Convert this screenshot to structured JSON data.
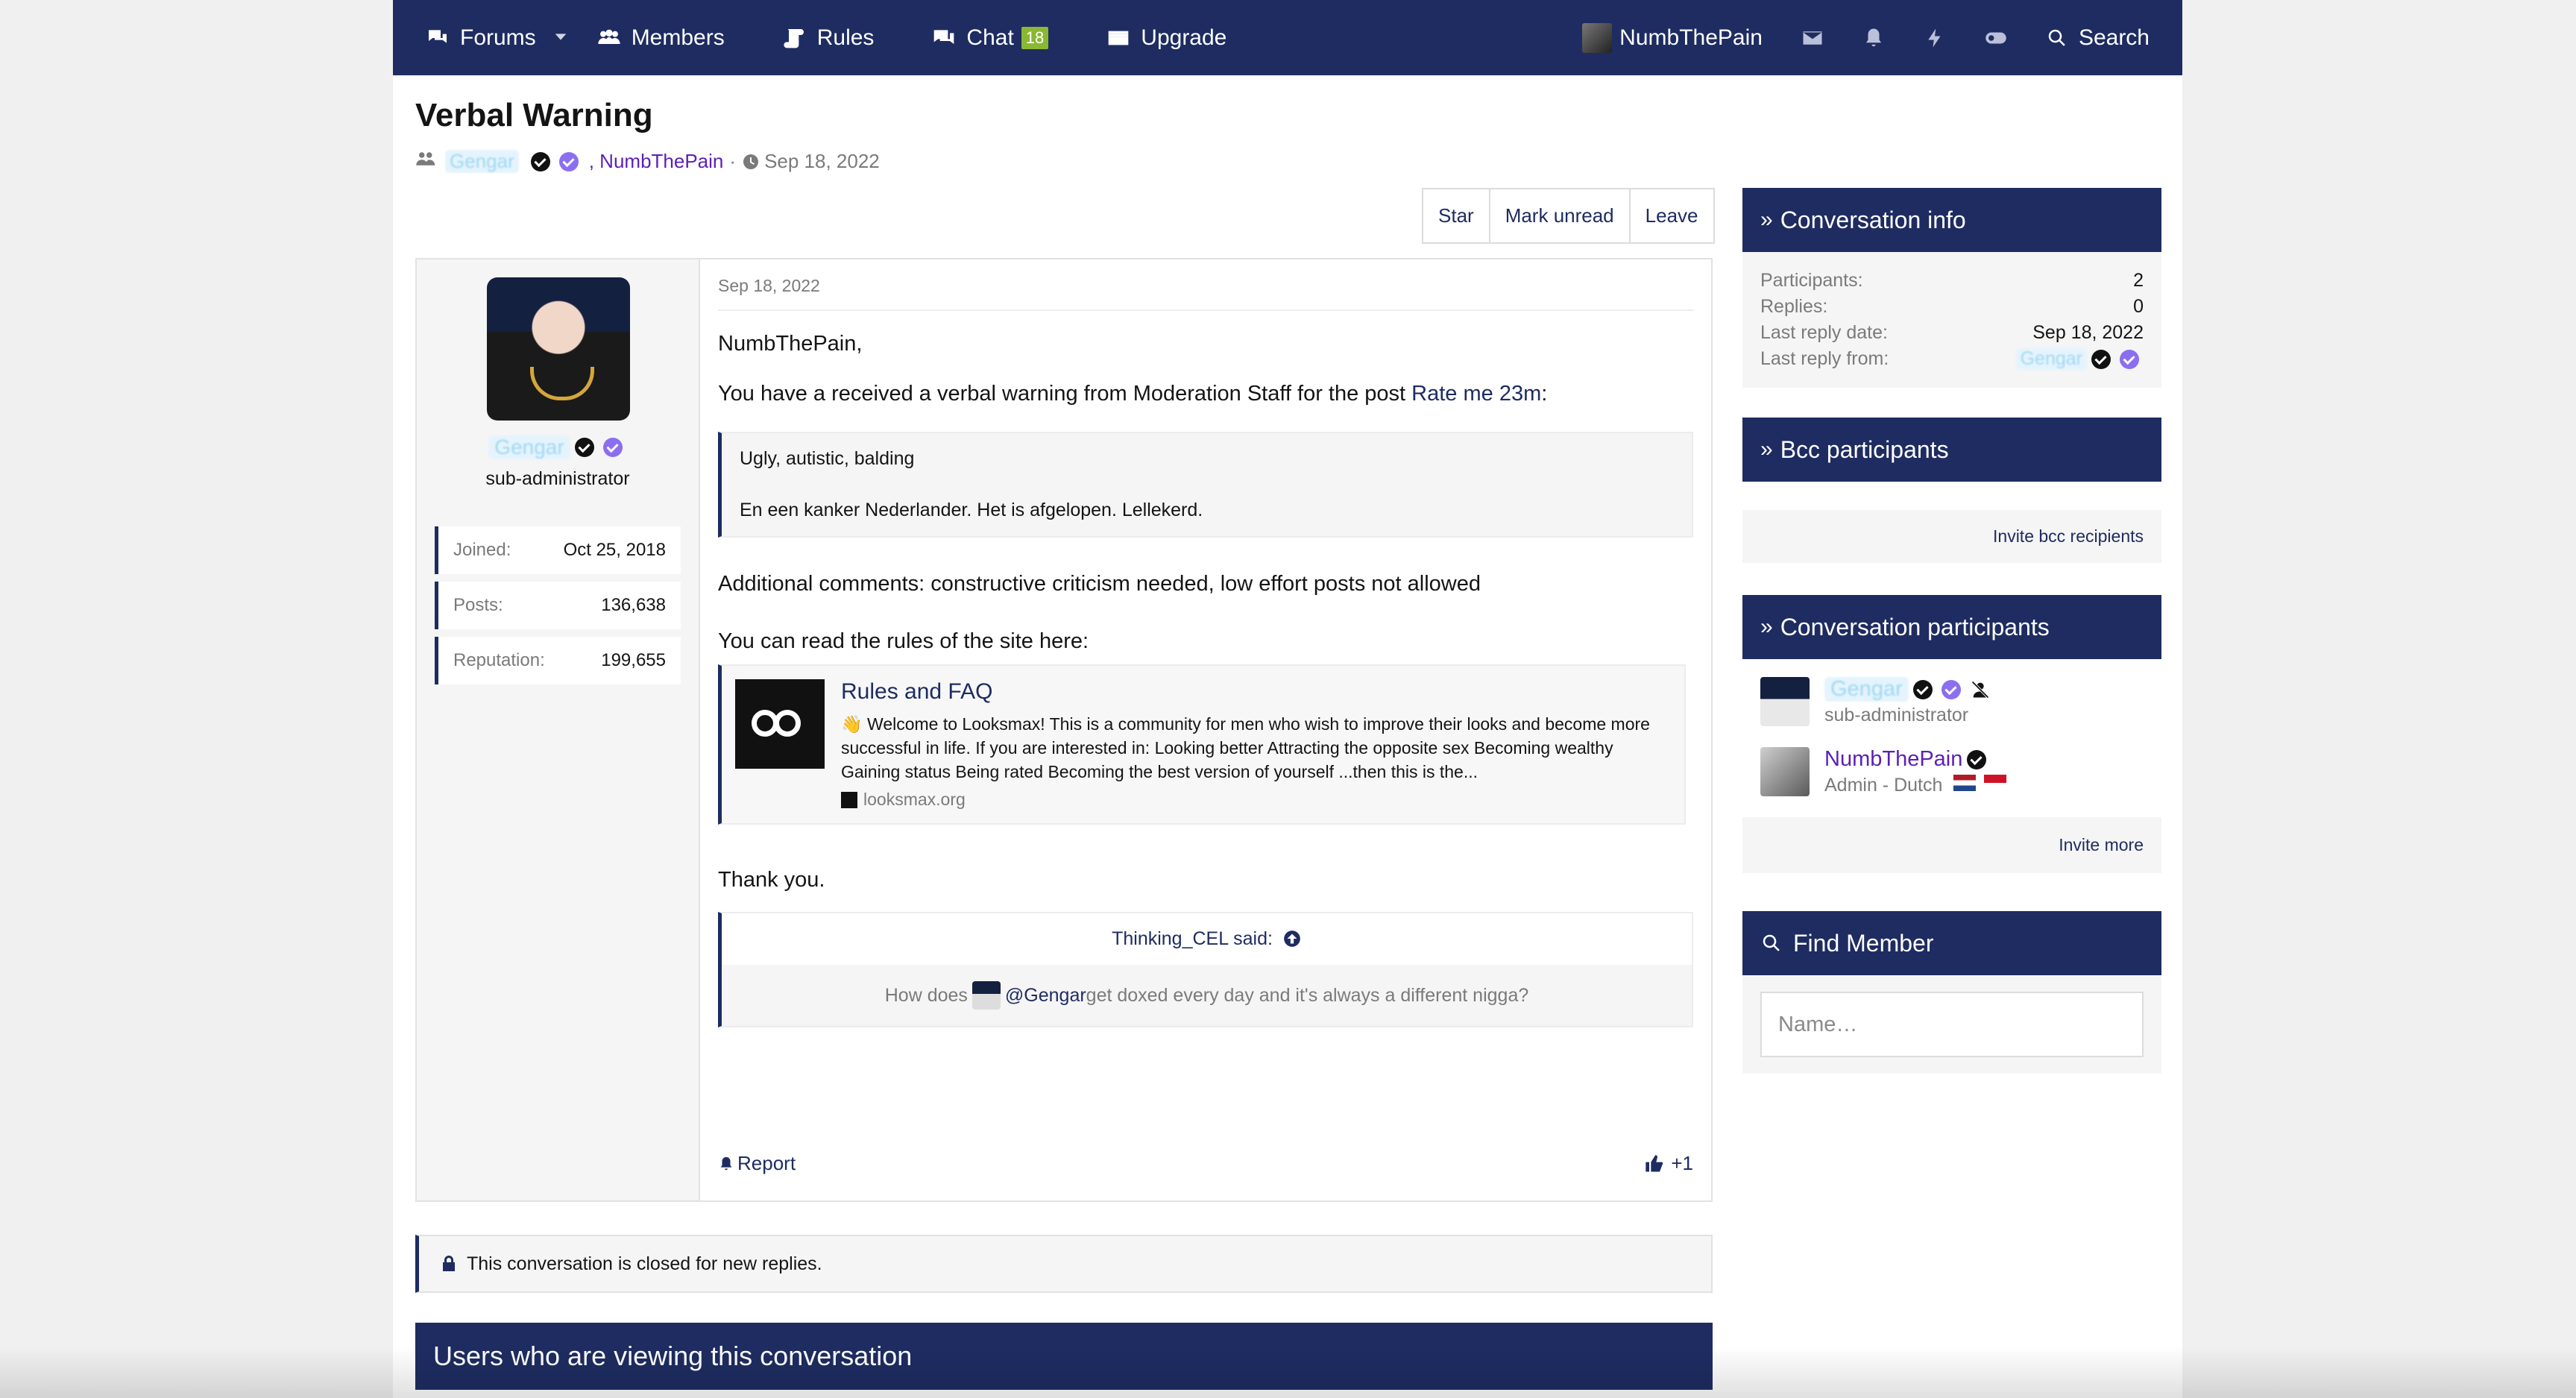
{
  "nav": {
    "forums": "Forums",
    "members": "Members",
    "rules": "Rules",
    "chat": "Chat",
    "chat_badge": "18",
    "upgrade": "Upgrade",
    "username": "NumbThePain",
    "search": "Search"
  },
  "conversation": {
    "title": "Verbal Warning",
    "participant_blurred": "Gengar",
    "participant_two": ", NumbThePain",
    "separator": "·",
    "date": "Sep 18, 2022"
  },
  "actions": {
    "star": "Star",
    "mark_unread": "Mark unread",
    "leave": "Leave"
  },
  "message": {
    "author": "Gengar",
    "author_role": "sub-administrator",
    "stats": [
      {
        "label": "Joined:",
        "value": "Oct 25, 2018"
      },
      {
        "label": "Posts:",
        "value": "136,638"
      },
      {
        "label": "Reputation:",
        "value": "199,655"
      }
    ],
    "date": "Sep 18, 2022",
    "greeting": "NumbThePain,",
    "warning_prefix": "You have a received a verbal warning from Moderation Staff for the post ",
    "warning_link": "Rate me 23m",
    "warning_suffix": ":",
    "quote_line1": "Ugly, autistic, balding",
    "quote_line2": "En een kanker Nederlander. Het is afgelopen. Lellekerd.",
    "comments": "Additional comments: constructive criticism needed, low effort posts not allowed",
    "rules_intro": "You can read the rules of the site here:",
    "embed": {
      "title": "Rules and FAQ",
      "description": "👋 Welcome to Looksmax! This is a community for men who wish to improve their looks and become more successful in life. If you are interested in: Looking better Attracting the opposite sex Becoming wealthy Gaining status Being rated Becoming the best version of yourself ...then this is the...",
      "domain": "looksmax.org"
    },
    "thanks": "Thank you.",
    "said_author": "Thinking_CEL said:",
    "said_prefix": "How does ",
    "said_mention": "@Gengar",
    "said_suffix": " get doxed every day and it's always a different nigga?",
    "report": "Report",
    "likes": "+1"
  },
  "closed_notice": "This conversation is closed for new replies.",
  "viewing_title": "Users who are viewing this conversation",
  "sidebar": {
    "info_title": "Conversation info",
    "info": [
      {
        "label": "Participants:",
        "value": "2"
      },
      {
        "label": "Replies:",
        "value": "0"
      },
      {
        "label": "Last reply date:",
        "value": "Sep 18, 2022"
      }
    ],
    "last_reply_from_label": "Last reply from:",
    "last_reply_from_value": "Gengar",
    "bcc_title": "Bcc participants",
    "bcc_link": "Invite bcc recipients",
    "participants_title": "Conversation participants",
    "participants": [
      {
        "name": "Gengar",
        "role": "sub-administrator"
      },
      {
        "name": "NumbThePain",
        "role": "Admin - Dutch"
      }
    ],
    "invite_more": "Invite more",
    "find_title": "Find Member",
    "find_placeholder": "Name…"
  },
  "colors": {
    "brand": "#1e2c61",
    "link_purple": "#5b1fb8",
    "badge_green": "#8ab832",
    "verified_purple": "#8c6ef0"
  }
}
